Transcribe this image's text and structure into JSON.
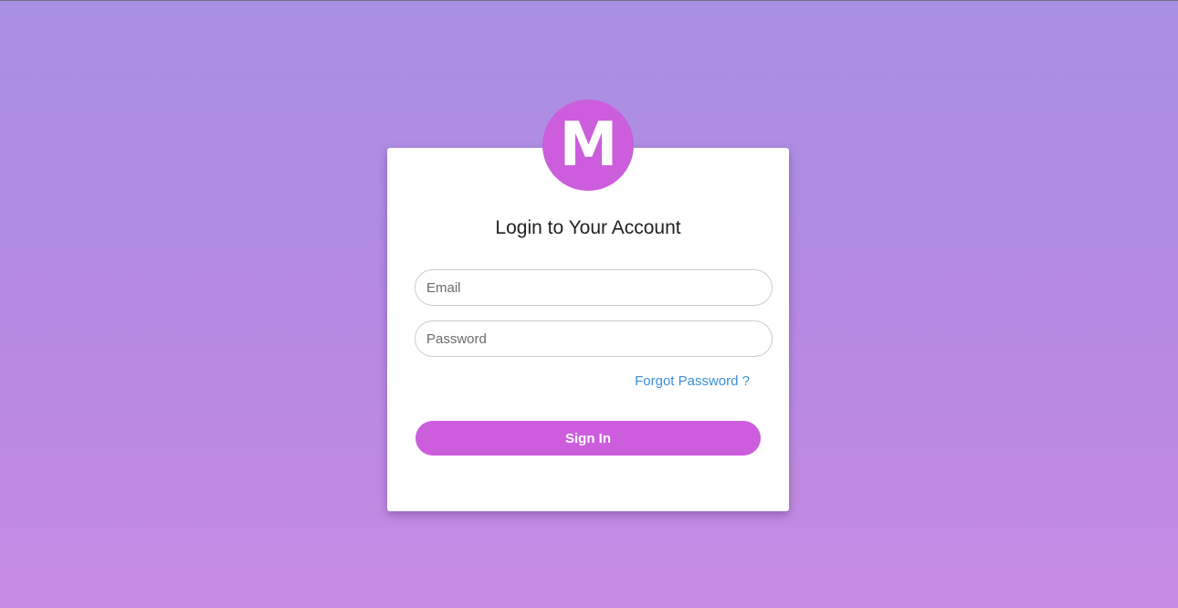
{
  "logo": {
    "letter": "M",
    "color": "#cc5ddd"
  },
  "login": {
    "title": "Login to Your Account",
    "email_placeholder": "Email",
    "password_placeholder": "Password",
    "forgot_label": "Forgot Password ?",
    "signin_label": "Sign In"
  },
  "colors": {
    "accent": "#cc5ddd",
    "link": "#3a8fd8",
    "background_top": "#a890e4",
    "background_bottom": "#c68ae2"
  }
}
